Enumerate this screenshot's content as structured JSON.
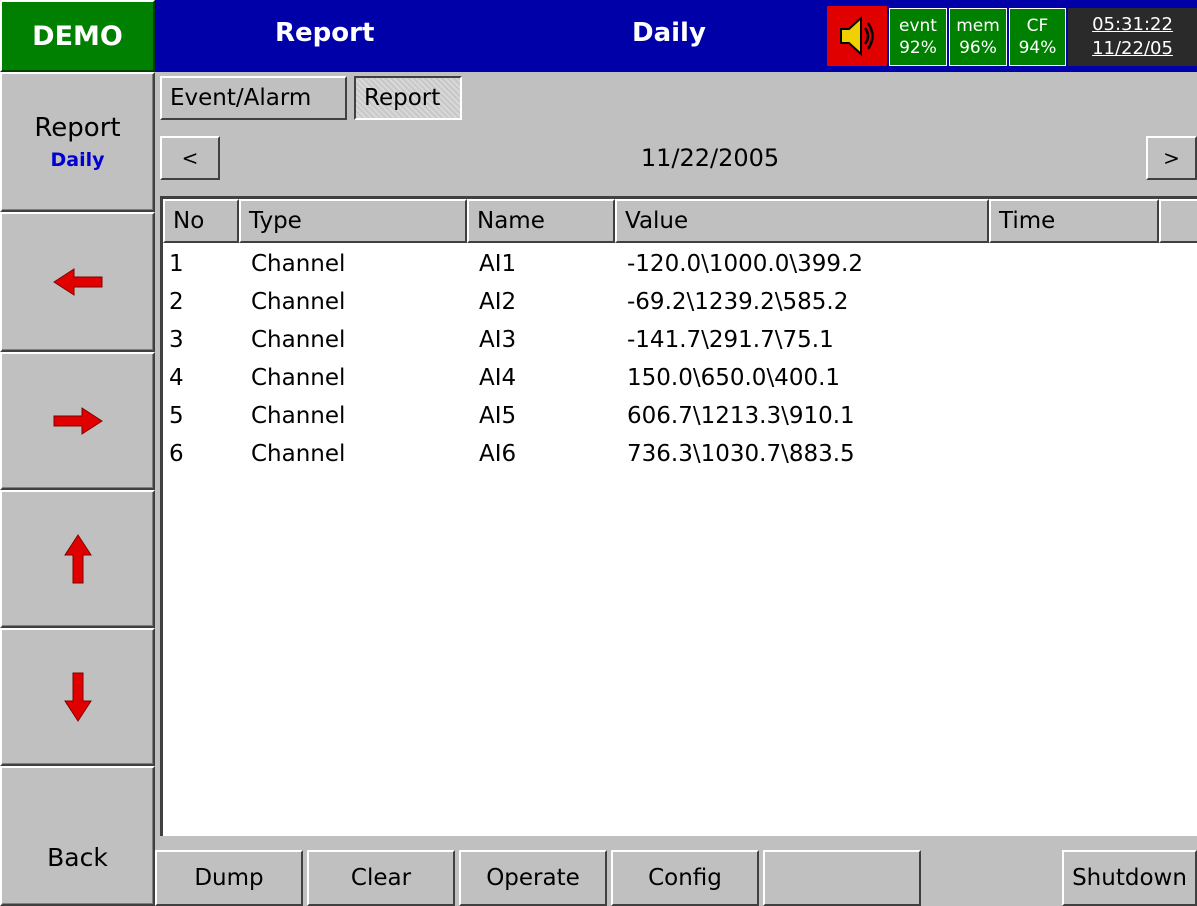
{
  "header": {
    "badge": "DEMO",
    "title": "Report",
    "mode": "Daily",
    "status": [
      {
        "label": "evnt",
        "value": "92%"
      },
      {
        "label": "mem",
        "value": "96%"
      },
      {
        "label": "CF",
        "value": "94%"
      }
    ],
    "clock": {
      "time": "05:31:22",
      "date": "11/22/05"
    }
  },
  "sidebar": {
    "report_label": "Report",
    "report_sub": "Daily",
    "back_label": "Back"
  },
  "tabs": [
    {
      "label": "Event/Alarm"
    },
    {
      "label": "Report"
    }
  ],
  "date_nav": {
    "prev": "<",
    "next": ">",
    "date": "11/22/2005"
  },
  "table": {
    "columns": [
      "No",
      "Type",
      "Name",
      "Value",
      "Time"
    ],
    "rows": [
      [
        "1",
        "Channel",
        "AI1",
        "-120.0\\1000.0\\399.2",
        ""
      ],
      [
        "2",
        "Channel",
        "AI2",
        "-69.2\\1239.2\\585.2",
        ""
      ],
      [
        "3",
        "Channel",
        "AI3",
        "-141.7\\291.7\\75.1",
        ""
      ],
      [
        "4",
        "Channel",
        "AI4",
        "150.0\\650.0\\400.1",
        ""
      ],
      [
        "5",
        "Channel",
        "AI5",
        "606.7\\1213.3\\910.1",
        ""
      ],
      [
        "6",
        "Channel",
        "AI6",
        "736.3\\1030.7\\883.5",
        ""
      ]
    ]
  },
  "bottom_buttons": [
    "Dump",
    "Clear",
    "Operate",
    "Config",
    "",
    "Shutdown"
  ],
  "colors": {
    "title_bg": "#0000a8",
    "demo_bg": "#008000",
    "arrow": "#e00000"
  }
}
